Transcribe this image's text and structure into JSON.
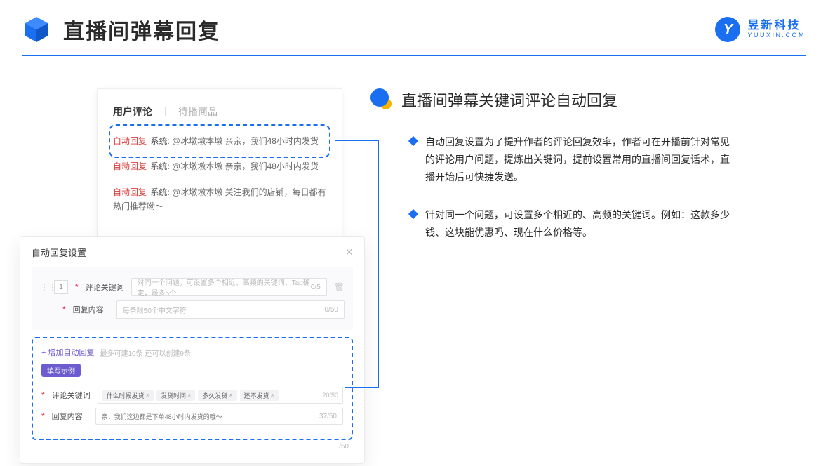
{
  "header": {
    "title": "直播间弹幕回复",
    "brand_cn": "昱新科技",
    "brand_en": "YUUXIN.COM",
    "logo_letter": "Y"
  },
  "comments": {
    "tab_active": "用户评论",
    "tab_inactive": "待播商品",
    "badge": "自动回复",
    "sys": "系统:",
    "items": [
      "@冰墩墩本墩 亲亲，我们48小时内发货",
      "@冰墩墩本墩 亲亲，我们48小时内发货",
      "@冰墩墩本墩 关注我们的店铺，每日都有热门推荐呦～"
    ]
  },
  "settings": {
    "title": "自动回复设置",
    "order": "1",
    "kw_label": "评论关键词",
    "kw_placeholder": "对同一个问题，可设置多个相近、高频的关键词，Tag确定，最多5个",
    "kw_count": "0/5",
    "content_label": "回复内容",
    "content_placeholder": "每条限50个中文字符",
    "content_count": "0/50",
    "add_link": "+ 增加自动回复",
    "add_hint": "最多可建10条 还可以创建9条",
    "example_badge": "填写示例",
    "ex_kw_label": "评论关键词",
    "ex_tags": [
      "什么时候发货",
      "发货时间",
      "多久发货",
      "还不发货"
    ],
    "ex_tag_count": "20/50",
    "ex_content_label": "回复内容",
    "ex_content_text": "亲，我们这边都是下单48小时内发货的哦～",
    "ex_content_count": "37/50",
    "bottom_count": "/50"
  },
  "right": {
    "section_title": "直播间弹幕关键词评论自动回复",
    "bullets": [
      "自动回复设置为了提升作者的评论回复效率，作者可在开播前针对常见的评论用户问题，提炼出关键词，提前设置常用的直播间回复话术，直播开始后可快捷发送。",
      "针对同一个问题，可设置多个相近的、高频的关键词。例如：这款多少钱、这块能优惠吗、现在什么价格等。"
    ]
  }
}
